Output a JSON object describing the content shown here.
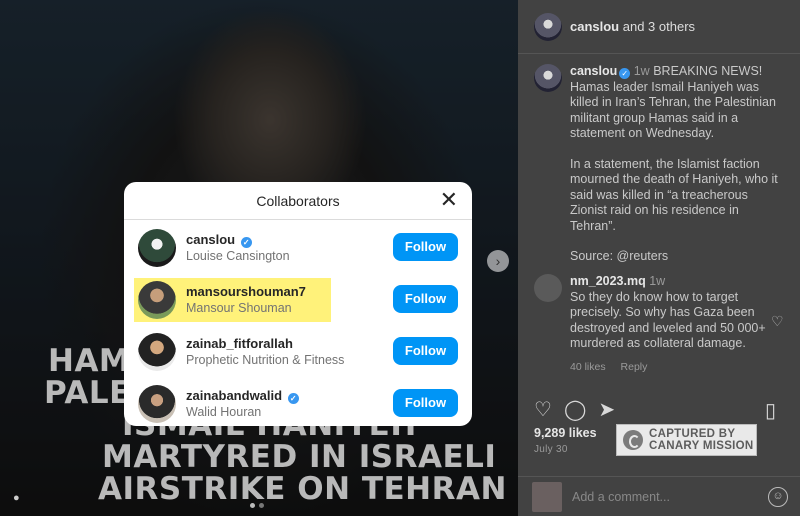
{
  "media": {
    "headline_lines": [
      "HAMAS",
      "PALES",
      "ISMAIL HANIYEH",
      "MARTYRED IN ISRAELI",
      "AIRSTRIKE ON TEHRAN"
    ],
    "next_icon": "chevron-right-icon"
  },
  "post": {
    "header": {
      "username": "canslou",
      "others": "and 3 others"
    },
    "caption": {
      "username": "canslou",
      "time": "1w",
      "paragraphs": [
        "BREAKING NEWS! Hamas leader Ismail Haniyeh was killed in Iran’s Tehran, the Palestinian militant group Hamas said in a statement on Wednesday.",
        "In a statement, the Islamist faction mourned the death of Haniyeh, who it said was killed in “a treacherous Zionist raid on his residence in Tehran”.",
        "Source: @reuters"
      ]
    },
    "comment": {
      "username": "nm_2023.mq",
      "time": "1w",
      "text": "So they do know how to target precisely. So why has Gaza been destroyed and leveled and 50 000+ murdered as collateral damage.",
      "likes": "40 likes",
      "reply": "Reply"
    },
    "likes": "9,289 likes",
    "date": "July 30",
    "add_comment_placeholder": "Add a comment..."
  },
  "watermark": {
    "line1": "CAPTURED BY",
    "line2": "CANARY MISSION"
  },
  "modal": {
    "title": "Collaborators",
    "follow_label": "Follow",
    "highlight_color": "#fff27a",
    "collaborators": [
      {
        "username": "canslou",
        "full_name": "Louise Cansington",
        "verified": true
      },
      {
        "username": "mansourshouman7",
        "full_name": "Mansour Shouman",
        "verified": false
      },
      {
        "username": "zainab_fitforallah",
        "full_name": "Prophetic Nutrition & Fitness",
        "verified": false
      },
      {
        "username": "zainabandwalid",
        "full_name": "Walid Houran",
        "verified": true
      }
    ]
  },
  "colors": {
    "accent": "#0095f6",
    "verified": "#3897f0"
  }
}
